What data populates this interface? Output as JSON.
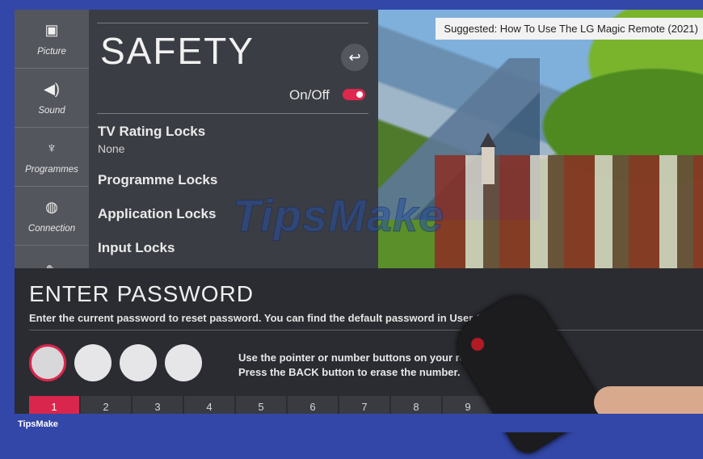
{
  "suggestion": "Suggested: How To Use The LG Magic Remote (2021)",
  "nav": [
    {
      "label": "Picture",
      "icon": "picture-icon"
    },
    {
      "label": "Sound",
      "icon": "sound-icon"
    },
    {
      "label": "Programmes",
      "icon": "satellite-icon"
    },
    {
      "label": "Connection",
      "icon": "connection-icon"
    },
    {
      "label": "",
      "icon": "wrench-icon"
    }
  ],
  "panel": {
    "title": "SAFETY",
    "toggle_label": "On/Off",
    "toggle_state": "on",
    "items": [
      {
        "label": "TV Rating Locks",
        "value": "None"
      },
      {
        "label": "Programme Locks"
      },
      {
        "label": "Application Locks"
      },
      {
        "label": "Input Locks"
      }
    ]
  },
  "watermark": "TipsMake",
  "password": {
    "title": "ENTER PASSWORD",
    "description": "Enter the current password to reset password. You can find the default password in User G",
    "hint_line1": "Use the pointer or number buttons on your rem",
    "hint_line2": "Press the BACK button to erase the number.",
    "digits_entered": 0,
    "keys": [
      "1",
      "2",
      "3",
      "4",
      "5",
      "6",
      "7",
      "8",
      "9"
    ]
  },
  "brand": "TipsMake",
  "colors": {
    "accent": "#d9264d",
    "frame": "#3347a8"
  }
}
